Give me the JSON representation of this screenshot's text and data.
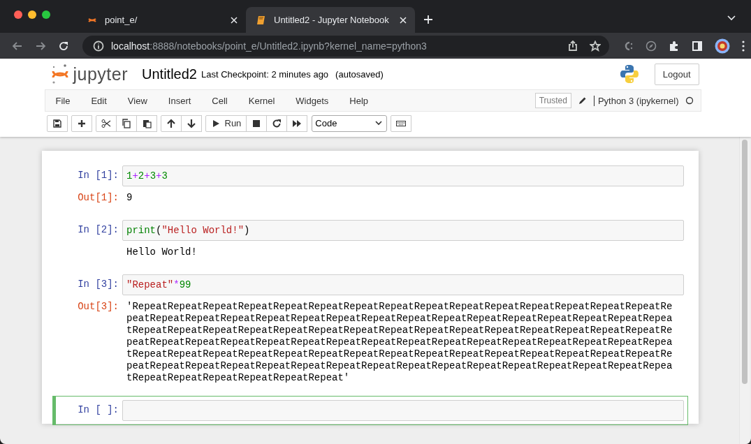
{
  "browser": {
    "tabs": [
      {
        "title": "point_e/",
        "selected": false
      },
      {
        "title": "Untitled2 - Jupyter Notebook",
        "selected": true
      }
    ],
    "url": {
      "host": "localhost",
      "rest": ":8888/notebooks/point_e/Untitled2.ipynb?kernel_name=python3"
    }
  },
  "header": {
    "logo_text": "jupyter",
    "notebook_name": "Untitled2",
    "checkpoint": "Last Checkpoint: 2 minutes ago",
    "autosave": "(autosaved)",
    "logout": "Logout"
  },
  "menu": {
    "items": [
      "File",
      "Edit",
      "View",
      "Insert",
      "Cell",
      "Kernel",
      "Widgets",
      "Help"
    ],
    "trusted": "Trusted",
    "kernel": "Python 3 (ipykernel)"
  },
  "toolbar": {
    "run": "Run",
    "cell_type": "Code"
  },
  "cells": [
    {
      "prompt": "In [1]:",
      "selected": false,
      "code": [
        {
          "kind": "number",
          "text": "1"
        },
        {
          "kind": "operator",
          "text": "+"
        },
        {
          "kind": "number",
          "text": "2"
        },
        {
          "kind": "operator",
          "text": "+"
        },
        {
          "kind": "number",
          "text": "3"
        },
        {
          "kind": "operator",
          "text": "+"
        },
        {
          "kind": "number",
          "text": "3"
        }
      ],
      "output": {
        "prompt": "Out[1]:",
        "text": "9"
      }
    },
    {
      "prompt": "In [2]:",
      "selected": false,
      "code": [
        {
          "kind": "builtin",
          "text": "print"
        },
        {
          "kind": "punct",
          "text": "("
        },
        {
          "kind": "string",
          "text": "\"Hello World!\""
        },
        {
          "kind": "punct",
          "text": ")"
        }
      ],
      "output": {
        "text": "Hello World!"
      }
    },
    {
      "prompt": "In [3]:",
      "selected": false,
      "code": [
        {
          "kind": "string",
          "text": "\"Repeat\""
        },
        {
          "kind": "operator",
          "text": "*"
        },
        {
          "kind": "number",
          "text": "99"
        }
      ],
      "output": {
        "prompt": "Out[3]:",
        "text": "'RepeatRepeatRepeatRepeatRepeatRepeatRepeatRepeatRepeatRepeatRepeatRepeatRepeatRepeatRepeatRepeatRepeatRepeatRepeatRepeatRepeatRepeatRepeatRepeatRepeatRepeatRepeatRepeatRepeatRepeatRepeatRepeatRepeatRepeatRepeatRepeatRepeatRepeatRepeatRepeatRepeatRepeatRepeatRepeatRepeatRepeatRepeatRepeatRepeatRepeatRepeatRepeatRepeatRepeatRepeatRepeatRepeatRepeatRepeatRepeatRepeatRepeatRepeatRepeatRepeatRepeatRepeatRepeatRepeatRepeatRepeatRepeatRepeatRepeatRepeatRepeatRepeatRepeatRepeatRepeatRepeatRepeatRepeatRepeatRepeatRepeatRepeatRepeatRepeatRepeatRepeatRepeatRepeatRepeatRepeatRepeatRepeatRepeatRepeat'"
      }
    },
    {
      "prompt": "In [ ]:",
      "selected": true
    }
  ]
}
